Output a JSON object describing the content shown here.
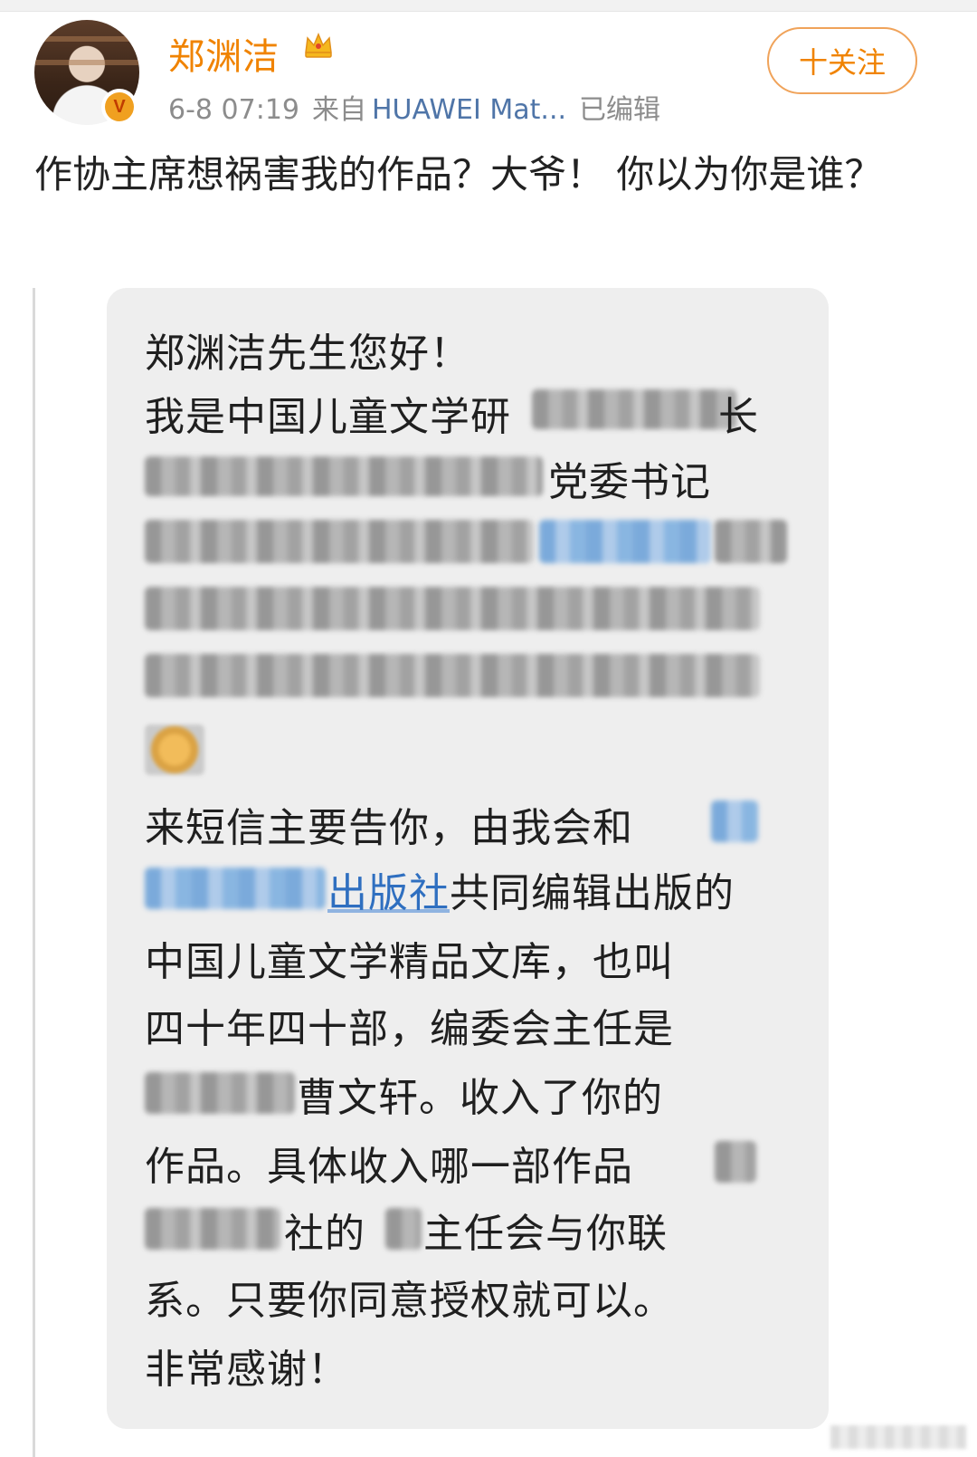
{
  "user": {
    "name": "郑渊洁",
    "verified_badge": "V",
    "badge_icon": "verified-v-badge",
    "crown_icon": "crown-icon"
  },
  "meta": {
    "time": "6-8 07:19",
    "from_prefix": "来自",
    "device": "HUAWEI Mat...",
    "edited": "已编辑"
  },
  "follow_button": "十关注",
  "post_text": "作协主席想祸害我的作品？大爷！ 你以为你是谁？",
  "message": {
    "line1": "郑渊洁先生您好！",
    "line2": "我是中国儿童文学研",
    "line2_tail": "长",
    "line3_tail": "党委书记",
    "line9": "来短信主要告你，由我会和",
    "line10_link": "出版社",
    "line10": "共同编辑出版的",
    "line11": "中国儿童文学精品文库，也叫",
    "line12": "四十年四十部，编委会主任是",
    "line13": "曹文轩。收入了你的",
    "line14": "作品。具体收入哪一部作品",
    "line15": "社的",
    "line15b": "主任会与你联",
    "line16": "系。只要你同意授权就可以。",
    "line17": "非常感谢！"
  },
  "colors": {
    "username": "#f08300",
    "device": "#4f75a8",
    "bubble_bg": "#eeeeee",
    "link": "#2f6fc0"
  }
}
